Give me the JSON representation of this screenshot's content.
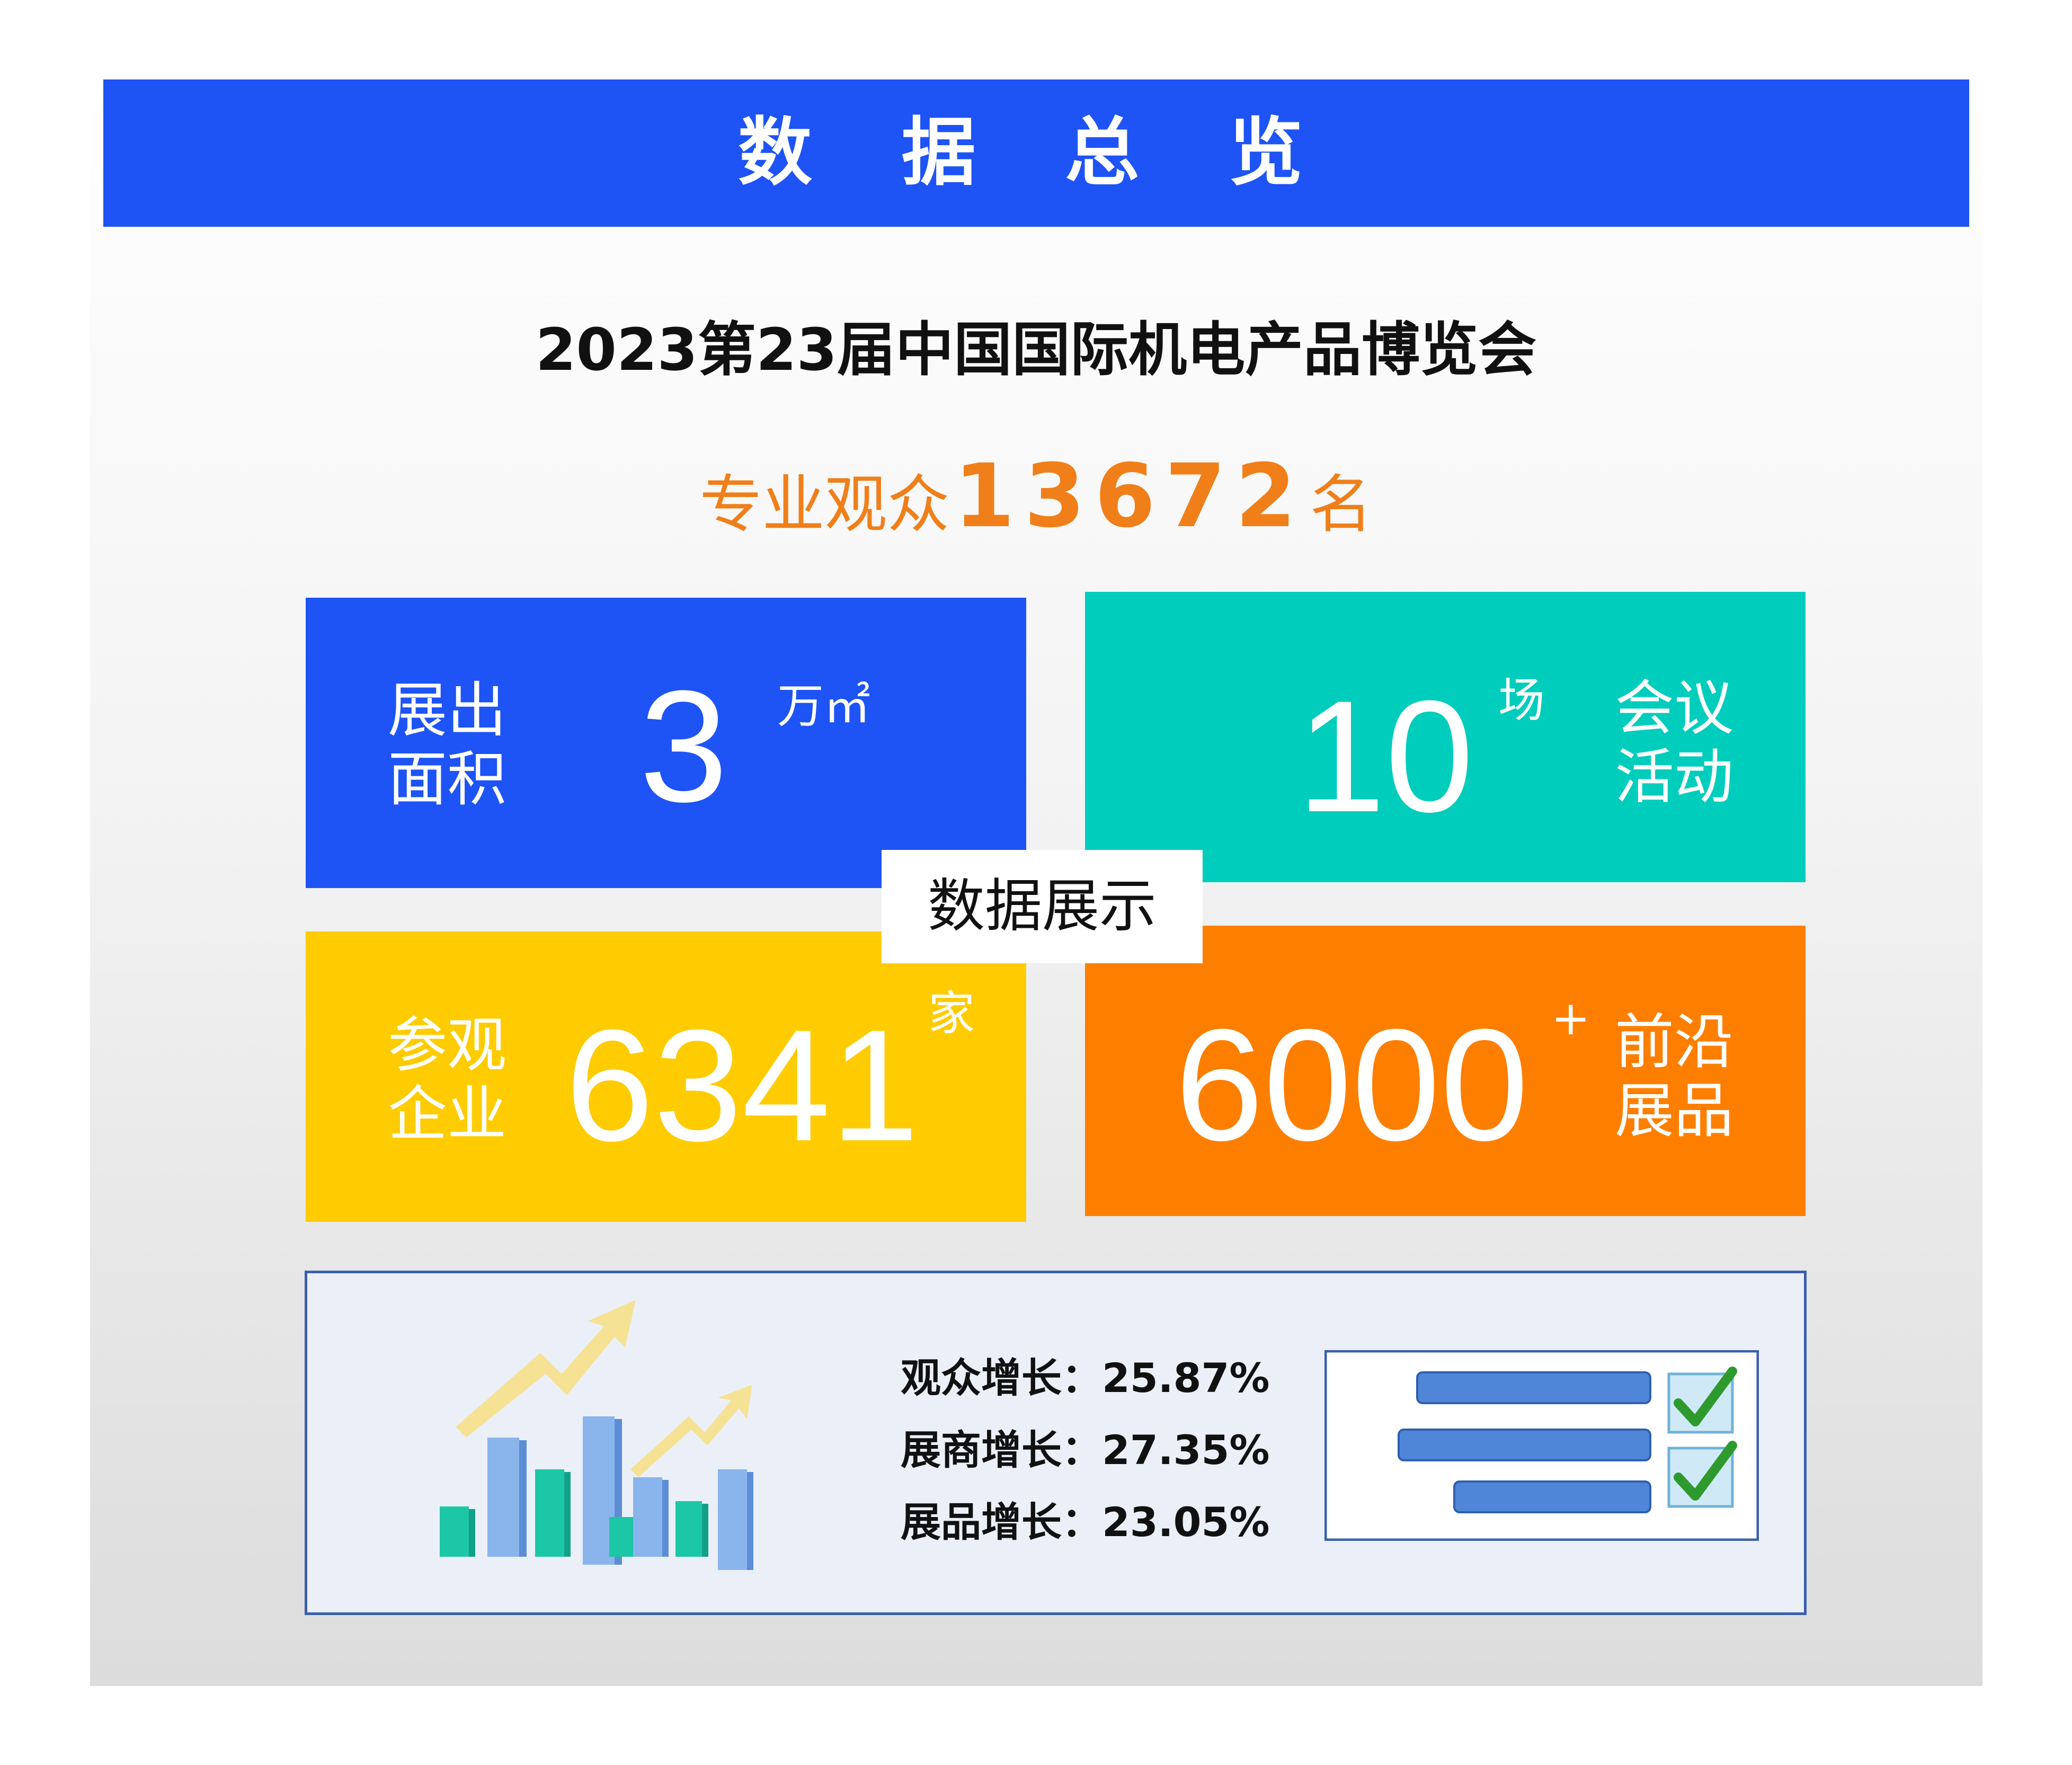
{
  "header": {
    "title": "数 据 总 览"
  },
  "event_title": "2023第23届中国国际机电产品博览会",
  "audience": {
    "label": "专业观众",
    "value": "13672",
    "unit": "名"
  },
  "tiles": {
    "area": {
      "label_line1": "展出",
      "label_line2": "面积",
      "value": "3",
      "unit": "万㎡",
      "color": "#1e54f5"
    },
    "meetings": {
      "label_line1": "会议",
      "label_line2": "活动",
      "value": "10",
      "unit": "场",
      "color": "#00cdbc"
    },
    "companies": {
      "label_line1": "参观",
      "label_line2": "企业",
      "value": "6341",
      "unit": "家",
      "color": "#fecc00"
    },
    "exhibits": {
      "label_line1": "前沿",
      "label_line2": "展品",
      "value": "6000",
      "unit": "+",
      "color": "#fe7f00"
    }
  },
  "center_label": "数据展示",
  "growth": [
    {
      "label": "观众增长：",
      "value": "25.87%"
    },
    {
      "label": "展商增长：",
      "value": "27.35%"
    },
    {
      "label": "展品增长：",
      "value": "23.05%"
    }
  ],
  "icons": [
    "bar-chart-growth-icon",
    "checklist-icon"
  ]
}
